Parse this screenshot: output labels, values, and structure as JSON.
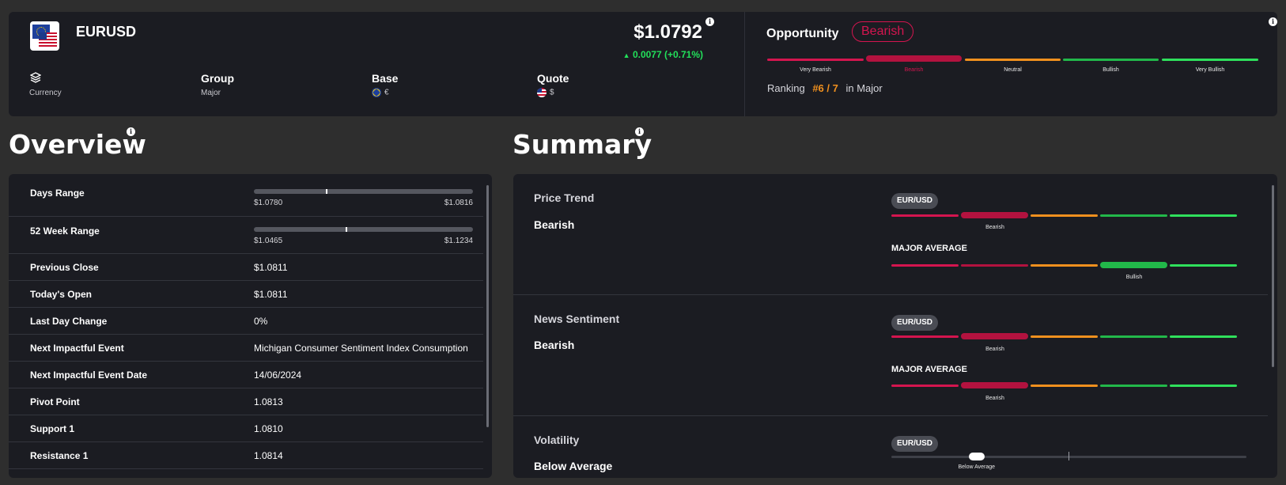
{
  "header": {
    "symbol": "EURUSD",
    "price": "$1.0792",
    "change": "0.0077 (+0.71%)",
    "meta": [
      {
        "label": "",
        "value": "Currency",
        "icon": "layers-icon"
      },
      {
        "label": "Group",
        "value": "Major"
      },
      {
        "label": "Base",
        "value": "€",
        "icon": "eu-flag-icon"
      },
      {
        "label": "Quote",
        "value": "$",
        "icon": "us-flag-icon"
      }
    ]
  },
  "opportunity": {
    "title": "Opportunity",
    "badge": "Bearish",
    "scale": [
      "Very Bearish",
      "Bearish",
      "Neutral",
      "Bullish",
      "Very Bullish"
    ],
    "active_index": 1,
    "ranking_label": "Ranking",
    "ranking_value": "#6 / 7",
    "ranking_suffix": "in Major"
  },
  "colors": {
    "very_bearish": "#d4154f",
    "bearish": "#b3123f",
    "neutral": "#f0901e",
    "bullish": "#22b84a",
    "very_bullish": "#2fe05c",
    "positive": "#22e05a",
    "accent_orange": "#f0901e"
  },
  "overview": {
    "title": "Overview",
    "days_range": {
      "label": "Days Range",
      "low": "$1.0780",
      "high": "$1.0816",
      "position": 0.33
    },
    "week52_range": {
      "label": "52 Week Range",
      "low": "$1.0465",
      "high": "$1.1234",
      "position": 0.42
    },
    "rows": [
      {
        "label": "Previous Close",
        "value": "$1.0811"
      },
      {
        "label": "Today's Open",
        "value": "$1.0811"
      },
      {
        "label": "Last Day Change",
        "value": "0%"
      },
      {
        "label": "Next Impactful Event",
        "value": "Michigan Consumer Sentiment Index Consumption"
      },
      {
        "label": "Next Impactful Event Date",
        "value": "14/06/2024"
      },
      {
        "label": "Pivot Point",
        "value": "1.0813"
      },
      {
        "label": "Support 1",
        "value": "1.0810"
      },
      {
        "label": "Resistance 1",
        "value": "1.0814"
      }
    ]
  },
  "summary": {
    "title": "Summary",
    "sections": [
      {
        "title": "Price Trend",
        "value": "Bearish",
        "pair": "EUR/USD",
        "pair_active": 1,
        "pair_active_label": "Bearish",
        "avg_label": "MAJOR AVERAGE",
        "avg_active": 3,
        "avg_active_label": "Bullish"
      },
      {
        "title": "News Sentiment",
        "value": "Bearish",
        "pair": "EUR/USD",
        "pair_active": 1,
        "pair_active_label": "Bearish",
        "avg_label": "MAJOR AVERAGE",
        "avg_active": 1,
        "avg_active_label": "Bearish"
      },
      {
        "title": "Volatility",
        "value": "Below Average",
        "pair": "EUR/USD",
        "level_label": "Below Average",
        "level": 0.24
      }
    ]
  }
}
